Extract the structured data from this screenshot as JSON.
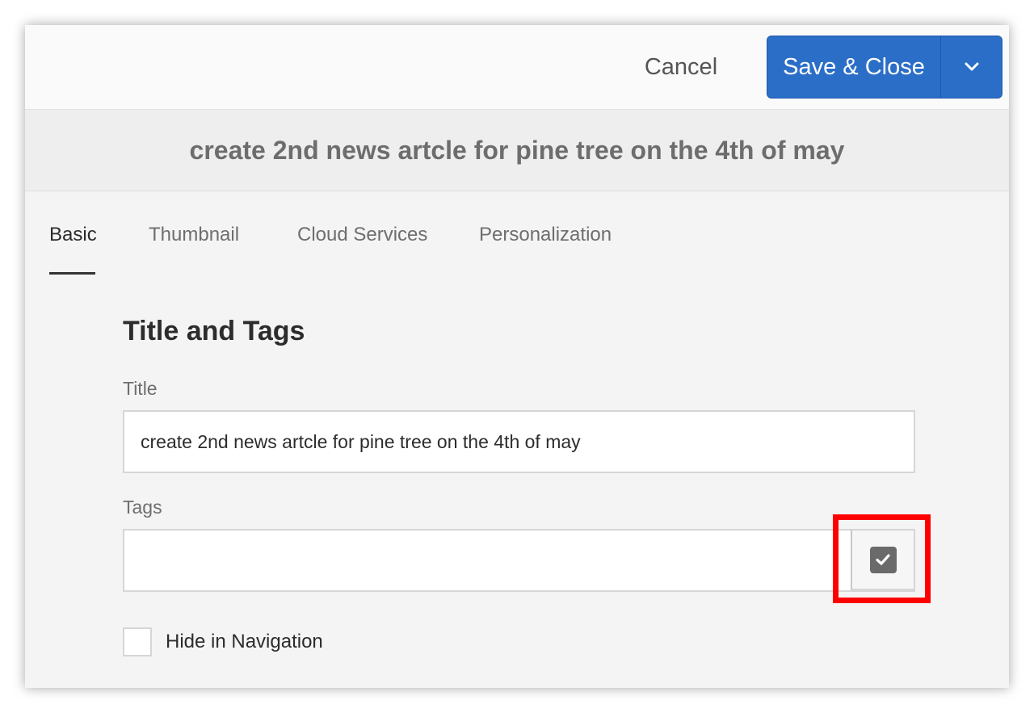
{
  "header": {
    "cancel_label": "Cancel",
    "save_label": "Save & Close",
    "save_menu_icon": "chevron-down-icon",
    "accent_color": "#2b6ec8"
  },
  "page_title": "create 2nd news artcle for pine tree on the 4th of may",
  "tabs": [
    {
      "label": "Basic",
      "active": true
    },
    {
      "label": "Thumbnail",
      "active": false
    },
    {
      "label": "Cloud Services",
      "active": false
    },
    {
      "label": "Personalization",
      "active": false
    }
  ],
  "form": {
    "section_heading": "Title and Tags",
    "title_label": "Title",
    "title_value": "create 2nd news artcle for pine tree on the 4th of may",
    "tags_label": "Tags",
    "tags_value": "",
    "tags_picker_icon": "checkbox-checked-icon",
    "hide_in_navigation_label": "Hide in Navigation",
    "hide_in_navigation_checked": false
  },
  "annotation": {
    "highlight_color": "#ff0000"
  }
}
